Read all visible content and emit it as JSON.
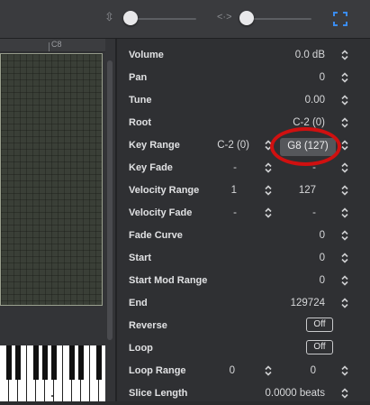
{
  "ruler": {
    "label": "C8"
  },
  "params": [
    {
      "label": "Volume",
      "value": "0.0 dB"
    },
    {
      "label": "Pan",
      "value": "0"
    },
    {
      "label": "Tune",
      "value": "0.00"
    },
    {
      "label": "Root",
      "value": "C-2 (0)"
    },
    {
      "label": "Key Range",
      "low": "C-2 (0)",
      "high": "G8 (127)"
    },
    {
      "label": "Key Fade",
      "low": "-",
      "high": "-"
    },
    {
      "label": "Velocity Range",
      "low": "1",
      "high": "127"
    },
    {
      "label": "Velocity Fade",
      "low": "-",
      "high": "-"
    },
    {
      "label": "Fade Curve",
      "value": "0"
    },
    {
      "label": "Start",
      "value": "0"
    },
    {
      "label": "Start Mod Range",
      "value": "0"
    },
    {
      "label": "End",
      "value": "129724"
    },
    {
      "label": "Reverse",
      "toggle": "Off"
    },
    {
      "label": "Loop",
      "toggle": "Off"
    },
    {
      "label": "Loop Range",
      "low": "0",
      "high": "0"
    },
    {
      "label": "Slice Length",
      "value": "0.0000 beats"
    }
  ],
  "colors": {
    "highlight": "#d01010",
    "grid": "#3a3f37"
  }
}
